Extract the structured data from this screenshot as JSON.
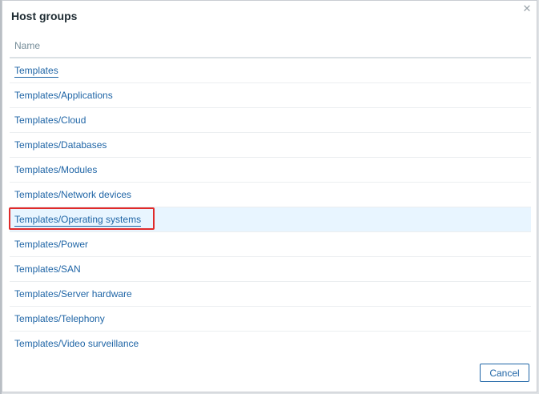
{
  "dialog": {
    "title": "Host groups",
    "close_icon": "close-icon"
  },
  "table": {
    "header": "Name",
    "rows": [
      "Templates",
      "Templates/Applications",
      "Templates/Cloud",
      "Templates/Databases",
      "Templates/Modules",
      "Templates/Network devices",
      "Templates/Operating systems",
      "Templates/Power",
      "Templates/SAN",
      "Templates/Server hardware",
      "Templates/Telephony",
      "Templates/Video surveillance"
    ],
    "selected_index": 6
  },
  "buttons": {
    "cancel": "Cancel"
  },
  "colors": {
    "link": "#1f65a6",
    "selected_row_bg": "#e8f5ff",
    "highlight_border": "#e02a2a"
  }
}
